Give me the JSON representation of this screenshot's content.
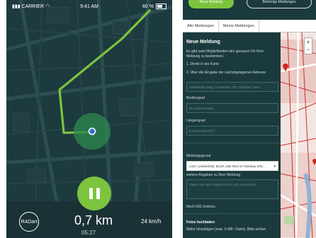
{
  "left_app": {
    "status": {
      "carrier": "CARRIER",
      "time": "9:41 AM",
      "battery": "60 %"
    },
    "radart_label": "RADart",
    "distance": "0,7 km",
    "elapsed": "05:27",
    "speed": "24 km/h",
    "colors": {
      "route": "#7cc43e",
      "background": "#1d3a3f",
      "accent": "#7cc43e"
    },
    "icons": [
      "wifi-icon",
      "battery-icon",
      "pause-icon",
      "location-dot-icon",
      "cursor-icon"
    ]
  },
  "right_app": {
    "top_buttons": {
      "primary": "Neue Meldung",
      "secondary": "Bisherige Meldungen"
    },
    "tabs": [
      "Alle Meldungen",
      "Meine Meldungen"
    ],
    "form": {
      "title": "Neue Meldung",
      "intro": "Es gibt zwei Möglichkeiten den genauen Ort Ihrer Meldung zu bestimmen:",
      "option1": "1. Direkt in der Karte",
      "option2": "2. Über die Eingabe der nächstgelegenen Adresse:",
      "address_placeholder": "Mittelstraße Weg, Fontanestr. Ort, Frankfurt, Hess",
      "lat_label": "Breitengrad",
      "lat_value": "50.112516373111",
      "lng_label": "Längengrad",
      "lng_value": "8.7016730317077",
      "reason_label": "Meldungsgrund",
      "reason_value": "Loch, Unebenheit, Bruch oder Riss im Oberbau erfa…",
      "more_label": "weitere Angaben zu Ihrer Meldung",
      "text_placeholder": "Tippen Sie sich möglichst kurz und sinnvoll kurz",
      "char_hint": "Noch 500 Zeichen.",
      "photos_label": "Fotos hochladen",
      "photos_hint": "Bilder hinzufügen (max. 5 MB / Datei). Bitte achten"
    },
    "map": {
      "zoom_in": "+",
      "zoom_out": "−"
    },
    "icons": [
      "map-pin-icon",
      "dropdown-arrow-icon"
    ]
  }
}
